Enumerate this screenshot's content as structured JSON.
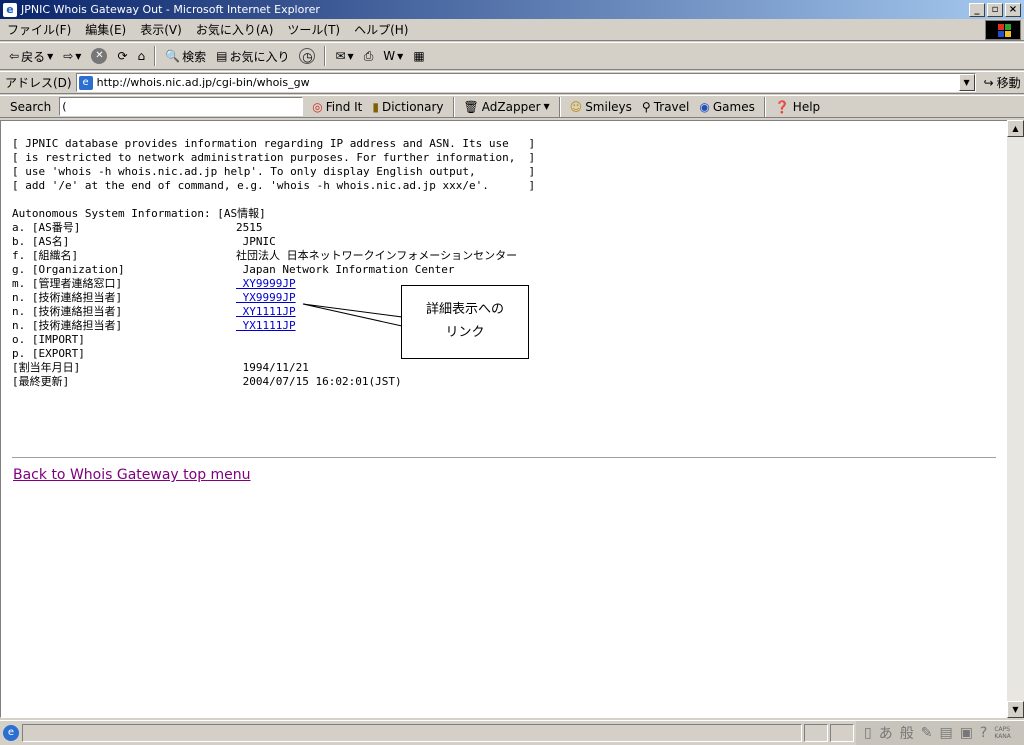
{
  "window": {
    "title": "JPNIC Whois Gateway Out - Microsoft Internet Explorer",
    "app_icon": "e"
  },
  "menu": [
    "ファイル(F)",
    "編集(E)",
    "表示(V)",
    "お気に入り(A)",
    "ツール(T)",
    "ヘルプ(H)"
  ],
  "toolbar": {
    "back": "戻る",
    "search": "検索",
    "favorites": "お気に入り"
  },
  "address": {
    "label": "アドレス(D)",
    "url": "http://whois.nic.ad.jp/cgi-bin/whois_gw",
    "go": "移動"
  },
  "links_bar": {
    "search_label": "Search",
    "search_value": "(",
    "items": [
      "Find It",
      "Dictionary",
      "AdZapper",
      "Smileys",
      "Travel",
      "Games",
      "Help"
    ]
  },
  "notice": [
    "[ JPNIC database provides information regarding IP address and ASN. Its use   ]",
    "[ is restricted to network administration purposes. For further information,  ]",
    "[ use 'whois -h whois.nic.ad.jp help'. To only display English output,        ]",
    "[ add '/e' at the end of command, e.g. 'whois -h whois.nic.ad.jp xxx/e'.      ]"
  ],
  "as_info": {
    "heading": "Autonomous System Information: [AS情報]",
    "rows": [
      {
        "key": "a. [AS番号]",
        "value": "2515"
      },
      {
        "key": "b. [AS名]",
        "value": " JPNIC"
      },
      {
        "key": "f. [組織名]",
        "value": "社団法人 日本ネットワークインフォメーションセンター"
      },
      {
        "key": "g. [Organization]",
        "value": " Japan Network Information Center"
      },
      {
        "key": "m. [管理者連絡窓口]",
        "value": " XY9999JP"
      },
      {
        "key": "n. [技術連絡担当者]",
        "value": " YX9999JP"
      },
      {
        "key": "n. [技術連絡担当者]",
        "value": " XY1111JP"
      },
      {
        "key": "n. [技術連絡担当者]",
        "value": " YX1111JP"
      },
      {
        "key": "o. [IMPORT]",
        "value": ""
      },
      {
        "key": "p. [EXPORT]",
        "value": ""
      },
      {
        "key": "[割当年月日]",
        "value": " 1994/11/21"
      },
      {
        "key": "[最終更新]",
        "value": " 2004/07/15 16:02:01(JST)"
      }
    ]
  },
  "callout": {
    "line1": "詳細表示への",
    "line2": "リンク"
  },
  "back_link": "Back to Whois Gateway top menu",
  "ime": {
    "a": "あ",
    "han": "般",
    "caps": "CAPS",
    "kana": "KANA"
  }
}
